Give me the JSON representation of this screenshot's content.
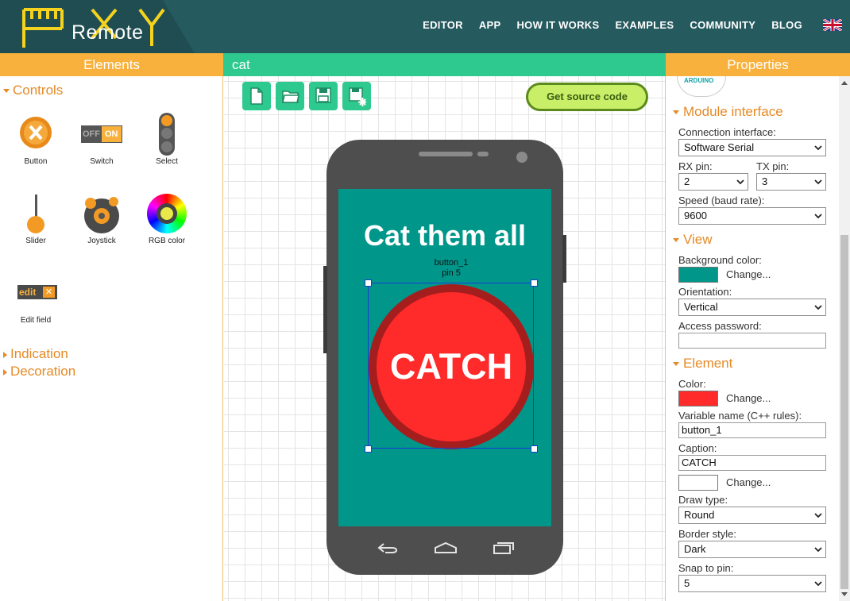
{
  "brand": {
    "logo_text": "RemoteXY",
    "logo_word": "Remote"
  },
  "nav": [
    "EDITOR",
    "APP",
    "HOW IT WORKS",
    "EXAMPLES",
    "COMMUNITY",
    "BLOG"
  ],
  "panels": {
    "elements_title": "Elements",
    "project_name": "cat",
    "properties_title": "Properties"
  },
  "elements": {
    "categories": {
      "controls": "Controls",
      "indication": "Indication",
      "decoration": "Decoration"
    },
    "tools": [
      {
        "label": "Button",
        "icon": "button-icon"
      },
      {
        "label": "Switch",
        "icon": "switch-icon"
      },
      {
        "label": "Select",
        "icon": "select-icon"
      },
      {
        "label": "Slider",
        "icon": "slider-icon"
      },
      {
        "label": "Joystick",
        "icon": "joystick-icon"
      },
      {
        "label": "RGB color",
        "icon": "rgb-color-icon"
      },
      {
        "label": "Edit field",
        "icon": "edit-field-icon"
      }
    ],
    "switch_off": "OFF",
    "switch_on": "ON",
    "edit_word": "edit"
  },
  "toolbar": {
    "source_button": "Get source code",
    "icons": [
      "new-file-icon",
      "open-folder-icon",
      "save-icon",
      "save-as-icon"
    ]
  },
  "screen": {
    "title": "Cat them all",
    "background": "#00968a",
    "selected_name": "button_1",
    "selected_pin": "pin 5",
    "button_caption": "CATCH",
    "button_color": "#ff2a2a",
    "button_border": "#a51e1e"
  },
  "properties": {
    "arduino_logo": "ARDUINO",
    "module": {
      "title": "Module interface",
      "connection_label": "Connection interface:",
      "connection_value": "Software Serial",
      "rx_label": "RX pin:",
      "rx_value": "2",
      "tx_label": "TX pin:",
      "tx_value": "3",
      "speed_label": "Speed (baud rate):",
      "speed_value": "9600"
    },
    "view": {
      "title": "View",
      "bg_label": "Background color:",
      "change": "Change...",
      "orientation_label": "Orientation:",
      "orientation_value": "Vertical",
      "password_label": "Access password:",
      "password_value": ""
    },
    "element": {
      "title": "Element",
      "color_label": "Color:",
      "change": "Change...",
      "varname_label": "Variable name (C++ rules):",
      "varname_value": "button_1",
      "caption_label": "Caption:",
      "caption_value": "CATCH",
      "caption_color_change": "Change...",
      "drawtype_label": "Draw type:",
      "drawtype_value": "Round",
      "border_label": "Border style:",
      "border_value": "Dark",
      "snap_label": "Snap to pin:",
      "snap_value": "5"
    }
  },
  "colors": {
    "header": "#255a5f",
    "orange": "#f8b13c",
    "green": "#2ec98f",
    "accent_text": "#e58a26",
    "caption_color": "#ffffff"
  }
}
